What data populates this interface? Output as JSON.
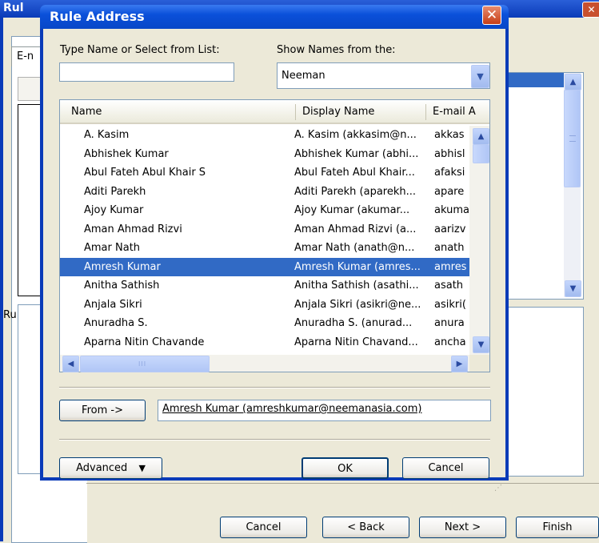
{
  "background_window": {
    "title_partial": "Rul",
    "tab_label": "E-n",
    "section_label": "Ru",
    "buttons": {
      "cancel": "Cancel",
      "back": "< Back",
      "next": "Next >",
      "finish": "Finish"
    }
  },
  "dialog": {
    "title": "Rule Address",
    "close_glyph": "✕",
    "type_name_label": "Type Name or Select from List:",
    "type_name_value": "",
    "show_names_label": "Show Names from the:",
    "show_names_value": "Neeman",
    "columns": [
      "Name",
      "Display Name",
      "E-mail A"
    ],
    "rows": [
      {
        "name": "A. Kasim",
        "display": "A. Kasim (akkasim@n...",
        "email": "akkas"
      },
      {
        "name": "Abhishek Kumar",
        "display": "Abhishek Kumar (abhi...",
        "email": "abhisl"
      },
      {
        "name": "Abul Fateh Abul Khair S",
        "display": "Abul Fateh Abul Khair...",
        "email": "afaksi"
      },
      {
        "name": "Aditi Parekh",
        "display": "Aditi Parekh (aparekh...",
        "email": "apare"
      },
      {
        "name": "Ajoy Kumar",
        "display": "Ajoy Kumar (akumar...",
        "email": "akuma"
      },
      {
        "name": "Aman Ahmad Rizvi",
        "display": "Aman Ahmad Rizvi (a...",
        "email": "aarizv"
      },
      {
        "name": "Amar Nath",
        "display": "Amar Nath (anath@n...",
        "email": "anath"
      },
      {
        "name": "Amresh Kumar",
        "display": "Amresh Kumar (amres...",
        "email": "amres"
      },
      {
        "name": "Anitha Sathish",
        "display": "Anitha Sathish (asathi...",
        "email": "asath"
      },
      {
        "name": "Anjala Sikri",
        "display": "Anjala Sikri (asikri@ne...",
        "email": "asikri("
      },
      {
        "name": "Anuradha S.",
        "display": "Anuradha S. (anurad...",
        "email": "anura"
      },
      {
        "name": "Aparna Nitin Chavande",
        "display": "Aparna Nitin Chavand...",
        "email": "ancha"
      }
    ],
    "selected_index": 7,
    "from_button": "From ->",
    "from_value": "Amresh Kumar (amreshkumar@neemanasia.com)",
    "advanced_button": "Advanced",
    "ok_button": "OK",
    "cancel_button": "Cancel",
    "scroll_thumb_glyph": "III"
  }
}
